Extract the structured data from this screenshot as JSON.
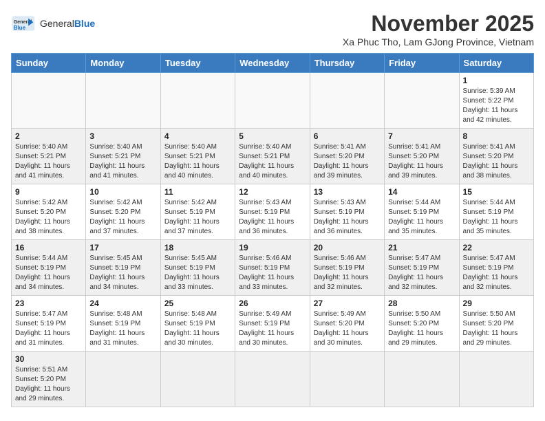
{
  "header": {
    "logo_general": "General",
    "logo_blue": "Blue",
    "month_title": "November 2025",
    "location": "Xa Phuc Tho, Lam GJong Province, Vietnam"
  },
  "days_of_week": [
    "Sunday",
    "Monday",
    "Tuesday",
    "Wednesday",
    "Thursday",
    "Friday",
    "Saturday"
  ],
  "weeks": [
    [
      {
        "day": "",
        "info": ""
      },
      {
        "day": "",
        "info": ""
      },
      {
        "day": "",
        "info": ""
      },
      {
        "day": "",
        "info": ""
      },
      {
        "day": "",
        "info": ""
      },
      {
        "day": "",
        "info": ""
      },
      {
        "day": "1",
        "info": "Sunrise: 5:39 AM\nSunset: 5:22 PM\nDaylight: 11 hours\nand 42 minutes."
      }
    ],
    [
      {
        "day": "2",
        "info": "Sunrise: 5:40 AM\nSunset: 5:21 PM\nDaylight: 11 hours\nand 41 minutes."
      },
      {
        "day": "3",
        "info": "Sunrise: 5:40 AM\nSunset: 5:21 PM\nDaylight: 11 hours\nand 41 minutes."
      },
      {
        "day": "4",
        "info": "Sunrise: 5:40 AM\nSunset: 5:21 PM\nDaylight: 11 hours\nand 40 minutes."
      },
      {
        "day": "5",
        "info": "Sunrise: 5:40 AM\nSunset: 5:21 PM\nDaylight: 11 hours\nand 40 minutes."
      },
      {
        "day": "6",
        "info": "Sunrise: 5:41 AM\nSunset: 5:20 PM\nDaylight: 11 hours\nand 39 minutes."
      },
      {
        "day": "7",
        "info": "Sunrise: 5:41 AM\nSunset: 5:20 PM\nDaylight: 11 hours\nand 39 minutes."
      },
      {
        "day": "8",
        "info": "Sunrise: 5:41 AM\nSunset: 5:20 PM\nDaylight: 11 hours\nand 38 minutes."
      }
    ],
    [
      {
        "day": "9",
        "info": "Sunrise: 5:42 AM\nSunset: 5:20 PM\nDaylight: 11 hours\nand 38 minutes."
      },
      {
        "day": "10",
        "info": "Sunrise: 5:42 AM\nSunset: 5:20 PM\nDaylight: 11 hours\nand 37 minutes."
      },
      {
        "day": "11",
        "info": "Sunrise: 5:42 AM\nSunset: 5:19 PM\nDaylight: 11 hours\nand 37 minutes."
      },
      {
        "day": "12",
        "info": "Sunrise: 5:43 AM\nSunset: 5:19 PM\nDaylight: 11 hours\nand 36 minutes."
      },
      {
        "day": "13",
        "info": "Sunrise: 5:43 AM\nSunset: 5:19 PM\nDaylight: 11 hours\nand 36 minutes."
      },
      {
        "day": "14",
        "info": "Sunrise: 5:44 AM\nSunset: 5:19 PM\nDaylight: 11 hours\nand 35 minutes."
      },
      {
        "day": "15",
        "info": "Sunrise: 5:44 AM\nSunset: 5:19 PM\nDaylight: 11 hours\nand 35 minutes."
      }
    ],
    [
      {
        "day": "16",
        "info": "Sunrise: 5:44 AM\nSunset: 5:19 PM\nDaylight: 11 hours\nand 34 minutes."
      },
      {
        "day": "17",
        "info": "Sunrise: 5:45 AM\nSunset: 5:19 PM\nDaylight: 11 hours\nand 34 minutes."
      },
      {
        "day": "18",
        "info": "Sunrise: 5:45 AM\nSunset: 5:19 PM\nDaylight: 11 hours\nand 33 minutes."
      },
      {
        "day": "19",
        "info": "Sunrise: 5:46 AM\nSunset: 5:19 PM\nDaylight: 11 hours\nand 33 minutes."
      },
      {
        "day": "20",
        "info": "Sunrise: 5:46 AM\nSunset: 5:19 PM\nDaylight: 11 hours\nand 32 minutes."
      },
      {
        "day": "21",
        "info": "Sunrise: 5:47 AM\nSunset: 5:19 PM\nDaylight: 11 hours\nand 32 minutes."
      },
      {
        "day": "22",
        "info": "Sunrise: 5:47 AM\nSunset: 5:19 PM\nDaylight: 11 hours\nand 32 minutes."
      }
    ],
    [
      {
        "day": "23",
        "info": "Sunrise: 5:47 AM\nSunset: 5:19 PM\nDaylight: 11 hours\nand 31 minutes."
      },
      {
        "day": "24",
        "info": "Sunrise: 5:48 AM\nSunset: 5:19 PM\nDaylight: 11 hours\nand 31 minutes."
      },
      {
        "day": "25",
        "info": "Sunrise: 5:48 AM\nSunset: 5:19 PM\nDaylight: 11 hours\nand 30 minutes."
      },
      {
        "day": "26",
        "info": "Sunrise: 5:49 AM\nSunset: 5:19 PM\nDaylight: 11 hours\nand 30 minutes."
      },
      {
        "day": "27",
        "info": "Sunrise: 5:49 AM\nSunset: 5:20 PM\nDaylight: 11 hours\nand 30 minutes."
      },
      {
        "day": "28",
        "info": "Sunrise: 5:50 AM\nSunset: 5:20 PM\nDaylight: 11 hours\nand 29 minutes."
      },
      {
        "day": "29",
        "info": "Sunrise: 5:50 AM\nSunset: 5:20 PM\nDaylight: 11 hours\nand 29 minutes."
      }
    ],
    [
      {
        "day": "30",
        "info": "Sunrise: 5:51 AM\nSunset: 5:20 PM\nDaylight: 11 hours\nand 29 minutes."
      },
      {
        "day": "",
        "info": ""
      },
      {
        "day": "",
        "info": ""
      },
      {
        "day": "",
        "info": ""
      },
      {
        "day": "",
        "info": ""
      },
      {
        "day": "",
        "info": ""
      },
      {
        "day": "",
        "info": ""
      }
    ]
  ],
  "colors": {
    "header_bg": "#3a7abf",
    "accent_blue": "#1a6fbf"
  }
}
